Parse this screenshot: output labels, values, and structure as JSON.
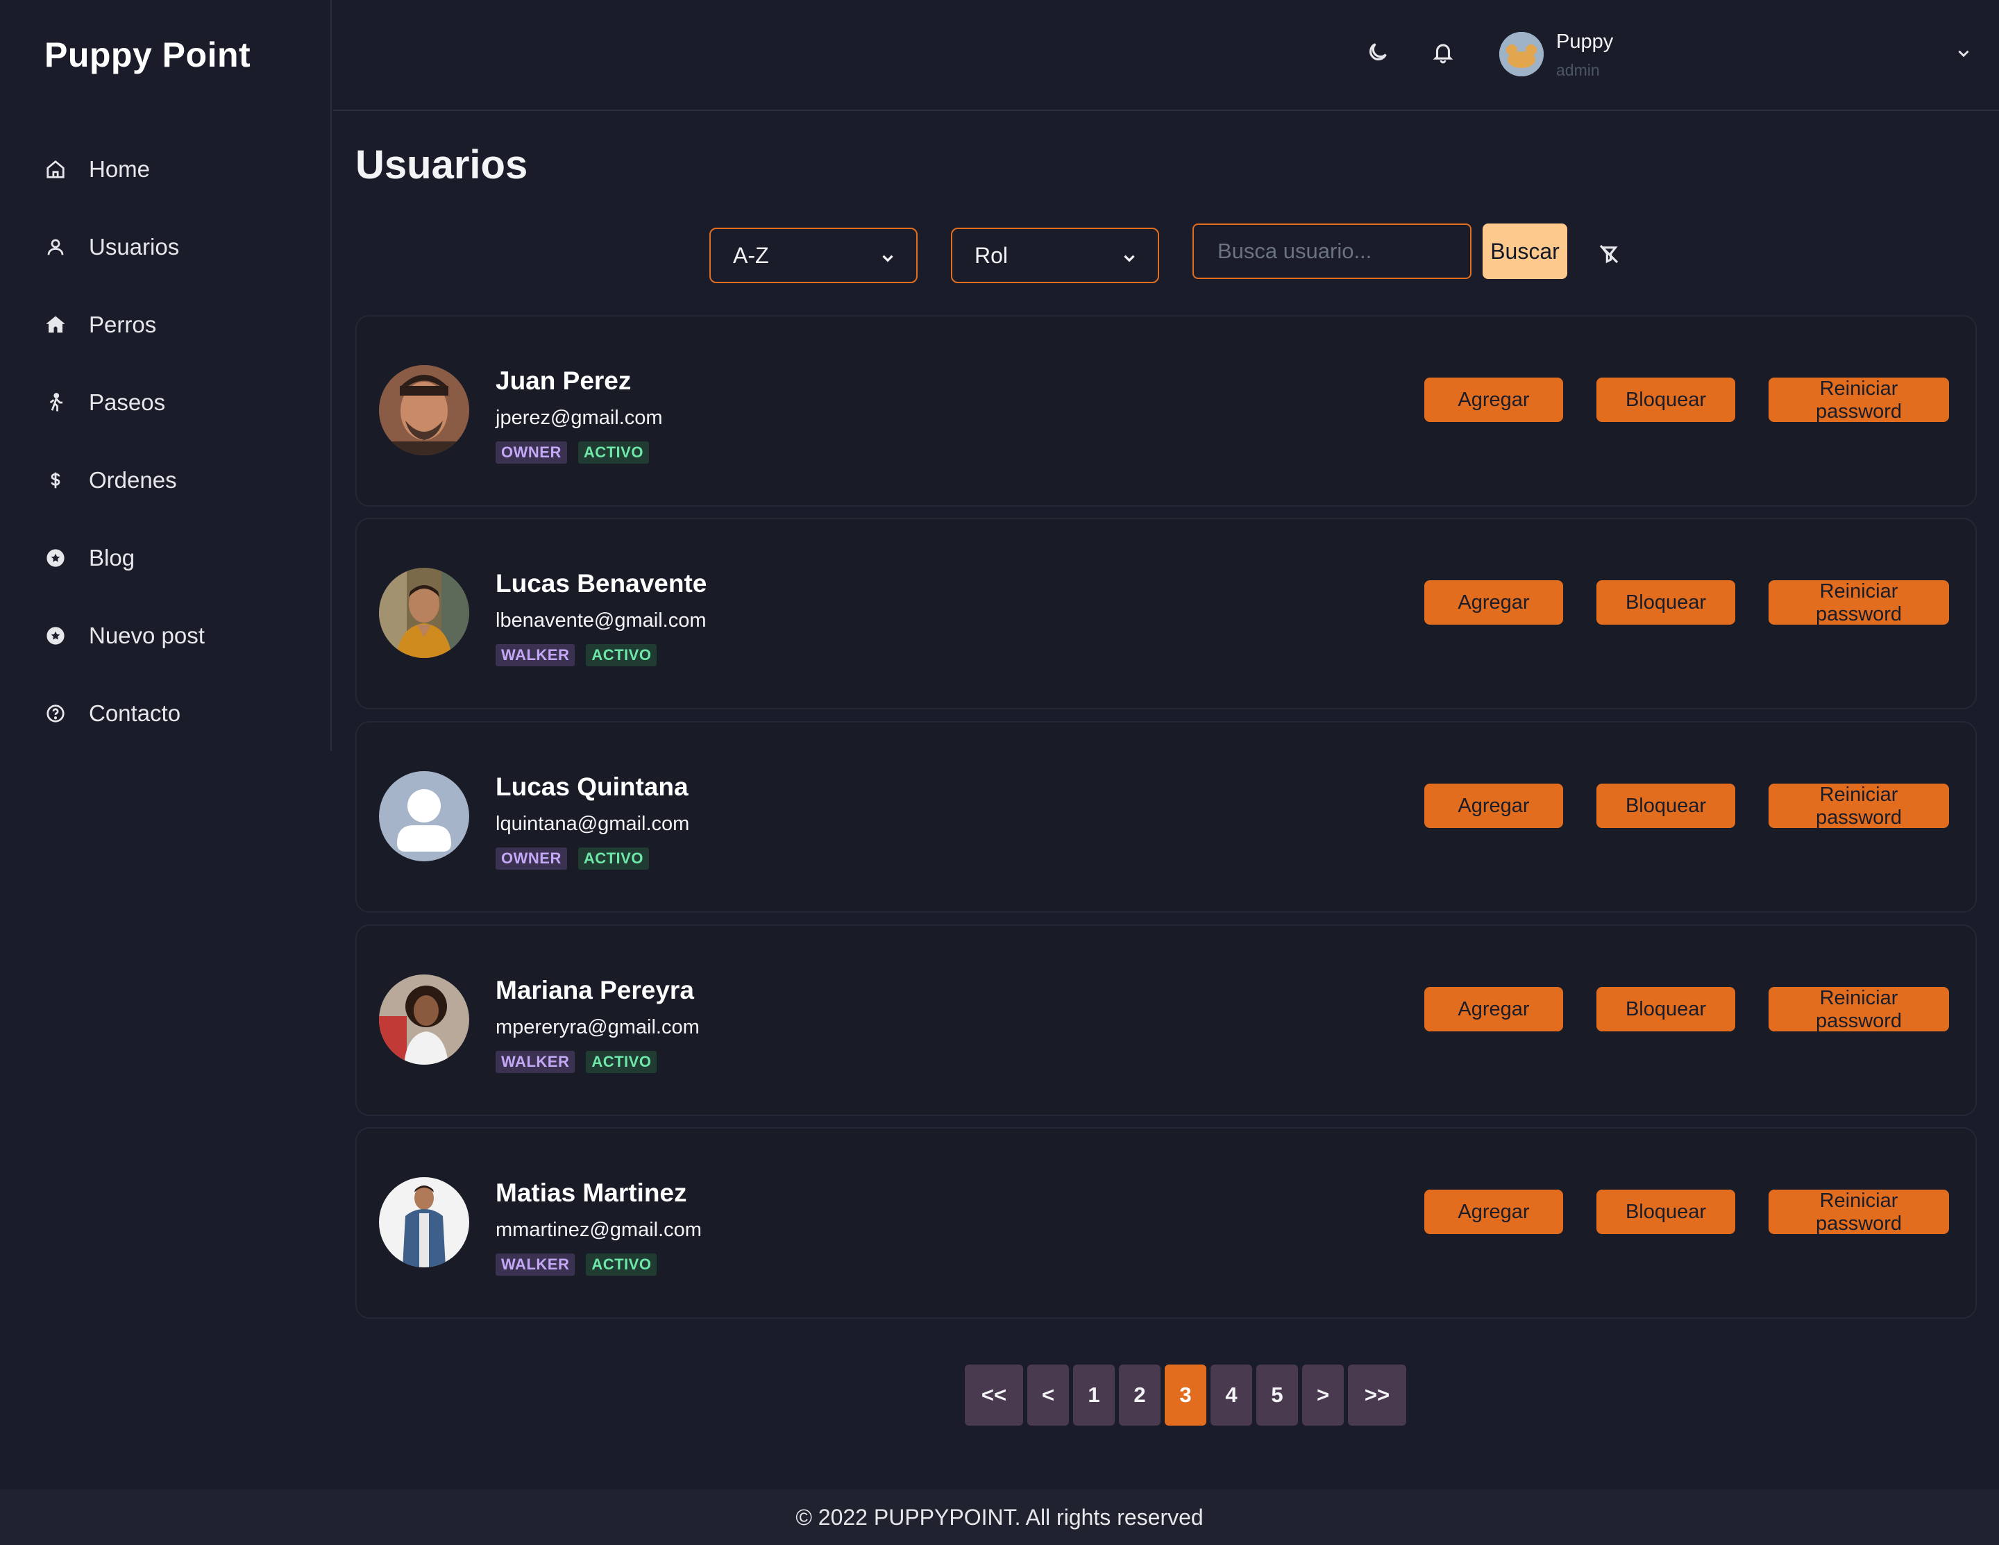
{
  "app": {
    "title": "Puppy Point"
  },
  "sidebar": {
    "items": [
      {
        "label": "Home",
        "icon": "home-icon"
      },
      {
        "label": "Usuarios",
        "icon": "user-icon"
      },
      {
        "label": "Perros",
        "icon": "dog-house-icon"
      },
      {
        "label": "Paseos",
        "icon": "walking-icon"
      },
      {
        "label": "Ordenes",
        "icon": "dollar-icon"
      },
      {
        "label": "Blog",
        "icon": "star-badge-icon"
      },
      {
        "label": "Nuevo post",
        "icon": "star-badge-icon"
      },
      {
        "label": "Contacto",
        "icon": "help-circle-icon"
      }
    ]
  },
  "header": {
    "user": {
      "name": "Puppy",
      "role": "admin"
    }
  },
  "main": {
    "title": "Usuarios",
    "filters": {
      "sort_value": "A-Z",
      "role_value": "Rol",
      "search_placeholder": "Busca usuario...",
      "search_button": "Buscar"
    },
    "users": [
      {
        "name": "Juan Perez",
        "email": "jperez@gmail.com",
        "role": "OWNER",
        "status": "ACTIVO"
      },
      {
        "name": "Lucas Benavente",
        "email": "lbenavente@gmail.com",
        "role": "WALKER",
        "status": "ACTIVO"
      },
      {
        "name": "Lucas Quintana",
        "email": "lquintana@gmail.com",
        "role": "OWNER",
        "status": "ACTIVO"
      },
      {
        "name": "Mariana Pereyra",
        "email": "mpereryra@gmail.com",
        "role": "WALKER",
        "status": "ACTIVO"
      },
      {
        "name": "Matias Martinez",
        "email": "mmartinez@gmail.com",
        "role": "WALKER",
        "status": "ACTIVO"
      }
    ],
    "actions": {
      "add": "Agregar",
      "block": "Bloquear",
      "reset": "Reiniciar password"
    },
    "pagination": {
      "first": "<<",
      "prev": "<",
      "pages": [
        "1",
        "2",
        "3",
        "4",
        "5"
      ],
      "current": "3",
      "next": ">",
      "last": ">>"
    }
  },
  "footer": {
    "text": "© 2022 PUPPYPOINT. All rights reserved"
  },
  "colors": {
    "background": "#1a1d29",
    "accent": "#e36d1f",
    "search_button": "#fdc98c",
    "page_button": "#4a3a4f"
  }
}
